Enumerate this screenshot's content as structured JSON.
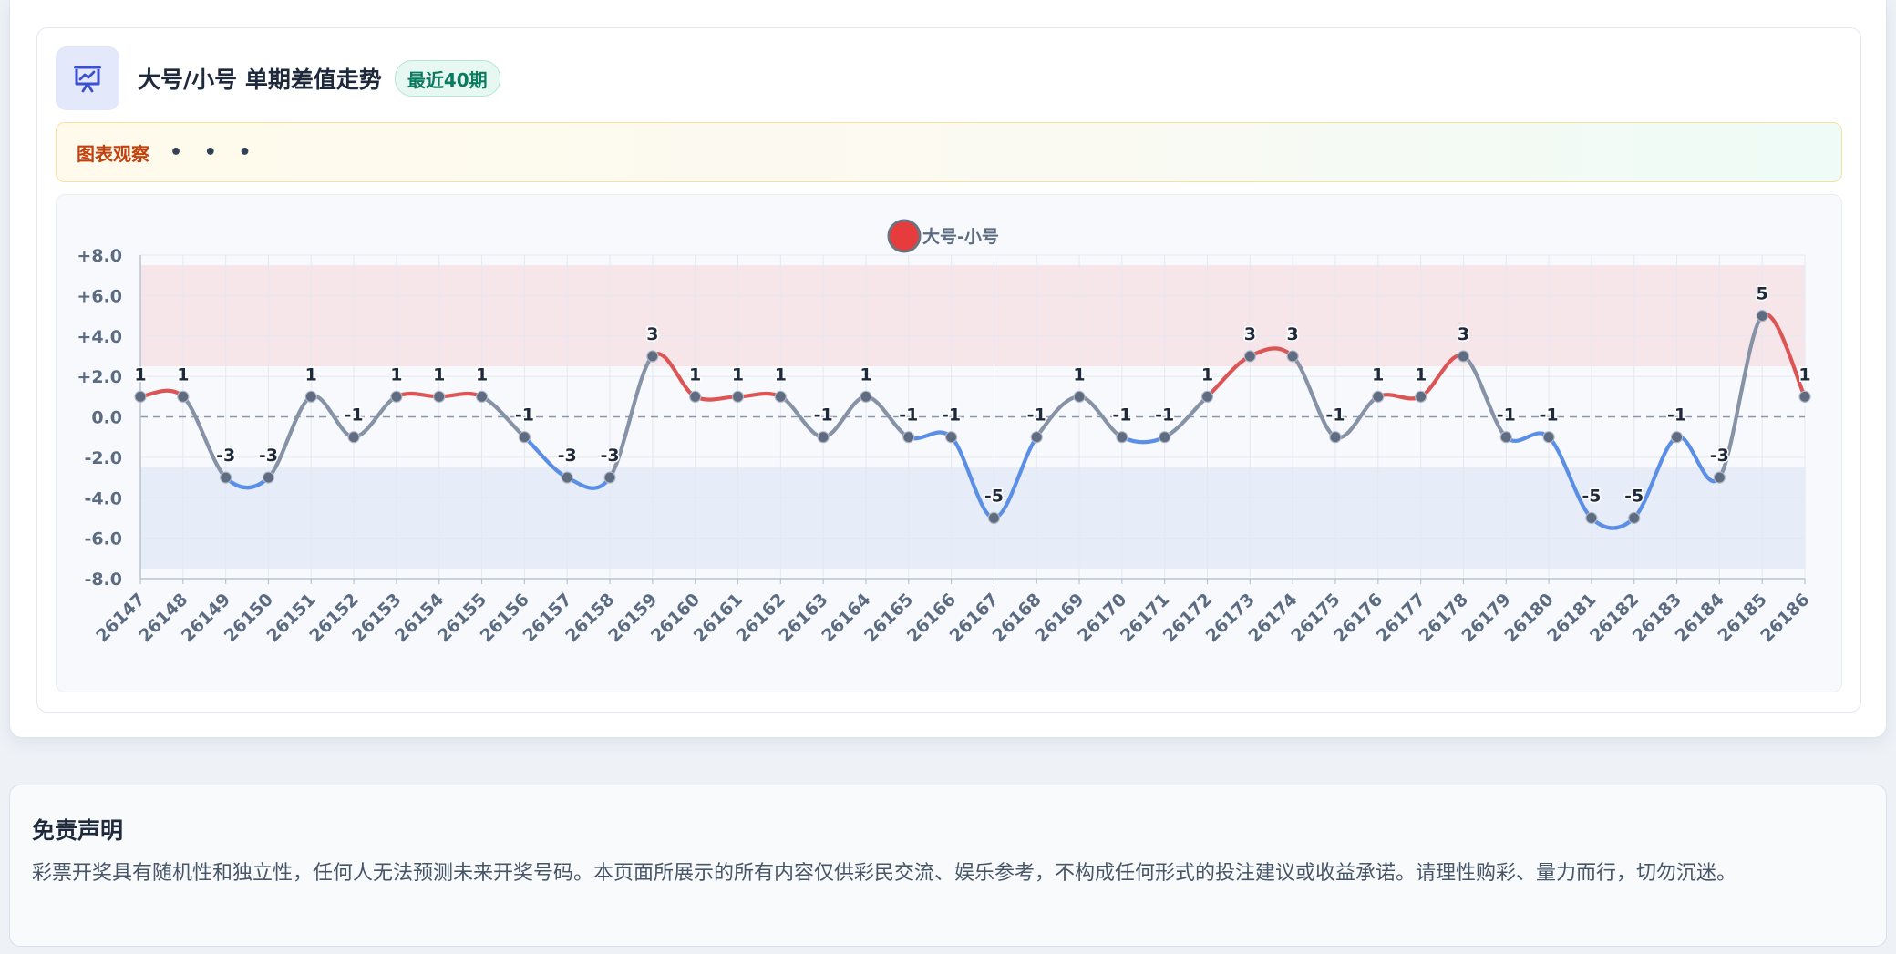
{
  "card": {
    "title": "大号/小号 单期差值走势",
    "badge": "最近40期",
    "observation_label": "图表观察",
    "observation_dots": "• • •",
    "icon": "presentation-chart-icon"
  },
  "chart_data": {
    "type": "line",
    "series": [
      {
        "name": "大号-小号",
        "values": [
          1,
          1,
          -3,
          -3,
          1,
          -1,
          1,
          1,
          1,
          -1,
          -3,
          -3,
          3,
          1,
          1,
          1,
          -1,
          1,
          -1,
          -1,
          -5,
          -1,
          1,
          -1,
          -1,
          1,
          3,
          3,
          -1,
          1,
          1,
          3,
          -1,
          -1,
          -5,
          -5,
          -1,
          -3,
          5,
          1
        ]
      }
    ],
    "categories": [
      "26147",
      "26148",
      "26149",
      "26150",
      "26151",
      "26152",
      "26153",
      "26154",
      "26155",
      "26156",
      "26157",
      "26158",
      "26159",
      "26160",
      "26161",
      "26162",
      "26163",
      "26164",
      "26165",
      "26166",
      "26167",
      "26168",
      "26169",
      "26170",
      "26171",
      "26172",
      "26173",
      "26174",
      "26175",
      "26176",
      "26177",
      "26178",
      "26179",
      "26180",
      "26181",
      "26182",
      "26183",
      "26184",
      "26185",
      "26186"
    ],
    "y_ticks": [
      "+8.0",
      "+6.0",
      "+4.0",
      "+2.0",
      "0.0",
      "-2.0",
      "-4.0",
      "-6.0",
      "-8.0"
    ],
    "ylim": [
      -8,
      8
    ],
    "bands": [
      {
        "from": 2.5,
        "to": 7.5,
        "color": "#f6e6ea"
      },
      {
        "from": -7.5,
        "to": -2.5,
        "color": "#e6ecf8"
      }
    ],
    "zero_line": "dashed",
    "grid": true,
    "legend_position": "top-center",
    "data_labels": true,
    "colors": {
      "positive": "#dc5555",
      "negative": "#5b8ee6",
      "neutral": "#8693a6",
      "point": "#5f6b80",
      "legend_fill": "#e63c3c",
      "legend_stroke": "#6b7280"
    }
  },
  "disclaimer": {
    "title": "免责声明",
    "text": "彩票开奖具有随机性和独立性，任何人无法预测未来开奖号码。本页面所展示的所有内容仅供彩民交流、娱乐参考，不构成任何形式的投注建议或收益承诺。请理性购彩、量力而行，切勿沉迷。"
  }
}
